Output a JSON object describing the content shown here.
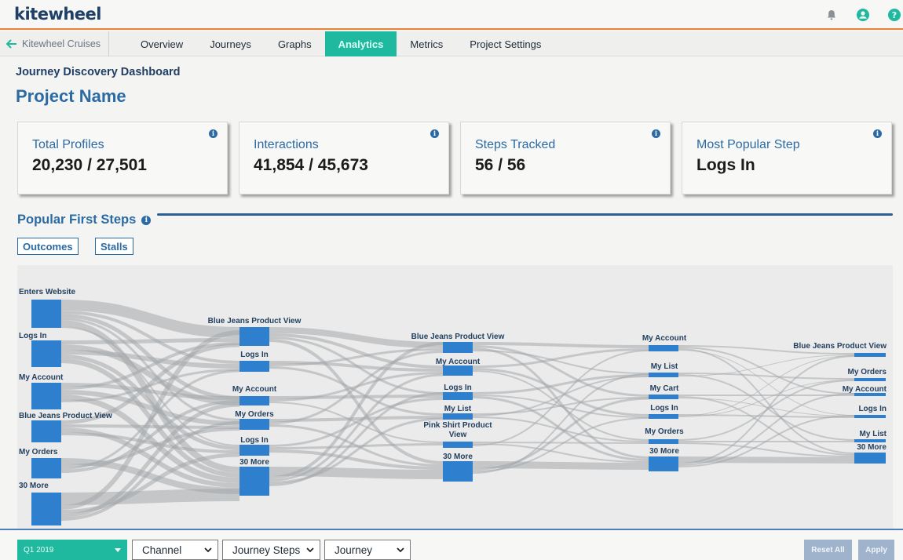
{
  "app": {
    "logo": "kitewheel"
  },
  "header": {
    "icons": [
      "bell-icon",
      "user-icon",
      "help-icon"
    ]
  },
  "nav": {
    "back_label": "Kitewheel Cruises",
    "tabs": [
      {
        "label": "Overview",
        "active": false
      },
      {
        "label": "Journeys",
        "active": false
      },
      {
        "label": "Graphs",
        "active": false
      },
      {
        "label": "Analytics",
        "active": true
      },
      {
        "label": "Metrics",
        "active": false
      },
      {
        "label": "Project Settings",
        "active": false
      }
    ]
  },
  "page": {
    "dashboard_title": "Journey Discovery Dashboard",
    "project_name": "Project Name"
  },
  "cards": [
    {
      "label": "Total Profiles",
      "value": "20,230 / 27,501"
    },
    {
      "label": "Interactions",
      "value": "41,854 / 45,673"
    },
    {
      "label": "Steps Tracked",
      "value": "56 / 56"
    },
    {
      "label": "Most Popular Step",
      "value": "Logs In"
    }
  ],
  "section": {
    "title": "Popular First Steps"
  },
  "toggles": {
    "outcomes": "Outcomes",
    "stalls": "Stalls"
  },
  "sankey": {
    "columns": [
      {
        "nodes": [
          "Enters Website",
          "Logs In",
          "My Account",
          "Blue Jeans Product View",
          "My Orders",
          "30 More"
        ]
      },
      {
        "nodes": [
          "Blue Jeans Product View",
          "Logs In",
          "My Account",
          "My Orders",
          "Logs In",
          "30 More"
        ]
      },
      {
        "nodes": [
          "Blue Jeans Product View",
          "My Account",
          "Logs In",
          "My List",
          "Pink Shirt Product View",
          "30 More"
        ]
      },
      {
        "nodes": [
          "My Account",
          "My List",
          "My Cart",
          "Logs In",
          "My Orders",
          "30 More"
        ]
      },
      {
        "nodes": [
          "Blue Jeans Product View",
          "My Orders",
          "My Account",
          "Logs In",
          "My List",
          "30 More"
        ]
      }
    ]
  },
  "filters": {
    "quarter": "Q1 2019",
    "channel": "Channel",
    "journey_steps": "Journey Steps",
    "journey": "Journey"
  },
  "actions": {
    "reset": "Reset All",
    "apply": "Apply"
  },
  "colors": {
    "accent": "#1fb99f",
    "brand": "#2b6aa3",
    "node": "#2f7fcf",
    "header_rule": "#e8833a"
  }
}
